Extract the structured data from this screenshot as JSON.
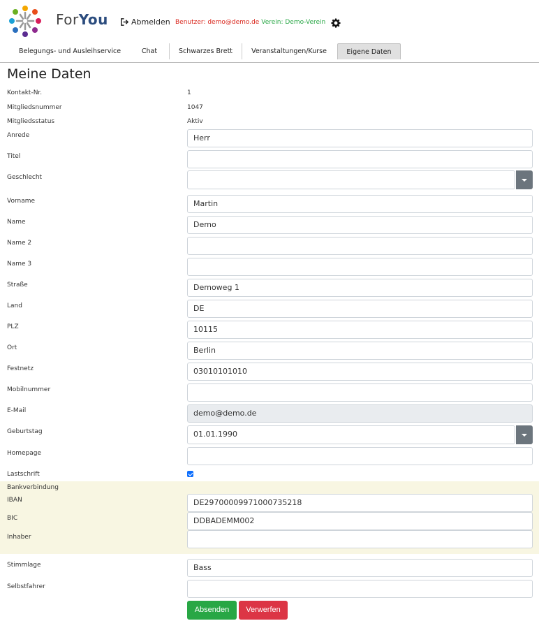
{
  "header": {
    "brand_prefix": "For",
    "brand_suffix": "You",
    "logout_label": "Abmelden",
    "user_text": "Benutzer: demo@demo.de",
    "verein_text": "Verein: Demo-Verein",
    "icons": [
      "logo-icon",
      "logout-icon",
      "gear-icon"
    ]
  },
  "tabs": [
    {
      "label": "Belegungs- und Ausleihservice",
      "active": false
    },
    {
      "label": "Chat",
      "active": false
    },
    {
      "label": "Schwarzes Brett",
      "active": false
    },
    {
      "label": "Veranstaltungen/Kurse",
      "active": false
    },
    {
      "label": "Eigene Daten",
      "active": true
    }
  ],
  "page_title": "Meine Daten",
  "info": {
    "kontakt_label": "Kontakt-Nr.",
    "kontakt_value": "1",
    "mitglied_label": "Mitgliedsnummer",
    "mitglied_value": "1047",
    "status_label": "Mitgliedsstatus",
    "status_value": "Aktiv"
  },
  "fields": {
    "anrede": {
      "label": "Anrede",
      "value": "Herr"
    },
    "titel": {
      "label": "Titel",
      "value": ""
    },
    "geschlecht": {
      "label": "Geschlecht",
      "value": ""
    },
    "vorname": {
      "label": "Vorname",
      "value": "Martin"
    },
    "name": {
      "label": "Name",
      "value": "Demo"
    },
    "name2": {
      "label": "Name 2",
      "value": ""
    },
    "name3": {
      "label": "Name 3",
      "value": ""
    },
    "strasse": {
      "label": "Straße",
      "value": "Demoweg 1"
    },
    "land": {
      "label": "Land",
      "value": "DE"
    },
    "plz": {
      "label": "PLZ",
      "value": "10115"
    },
    "ort": {
      "label": "Ort",
      "value": "Berlin"
    },
    "festnetz": {
      "label": "Festnetz",
      "value": "03010101010"
    },
    "mobil": {
      "label": "Mobilnummer",
      "value": ""
    },
    "email": {
      "label": "E-Mail",
      "value": "demo@demo.de"
    },
    "geburtstag": {
      "label": "Geburtstag",
      "value": "01.01.1990"
    },
    "homepage": {
      "label": "Homepage",
      "value": ""
    },
    "lastschrift": {
      "label": "Lastschrift",
      "checked": true
    }
  },
  "bank": {
    "section_label": "Bankverbindung",
    "iban": {
      "label": "IBAN",
      "value": "DE29700009971000735218"
    },
    "bic": {
      "label": "BIC",
      "value": "DDBADEMM002"
    },
    "inhaber": {
      "label": "Inhaber",
      "value": ""
    }
  },
  "extra": {
    "stimmlage": {
      "label": "Stimmlage",
      "value": "Bass"
    },
    "selbstfahrer": {
      "label": "Selbstfahrer",
      "value": ""
    }
  },
  "buttons": {
    "submit": "Absenden",
    "discard": "Verwerfen"
  },
  "colors": {
    "submit": "#28a745",
    "discard": "#dc3545",
    "user_text": "#d9261c",
    "verein_text": "#28a745",
    "bank_bg": "#f8f6e2",
    "checkbox": "#0d6efd"
  }
}
